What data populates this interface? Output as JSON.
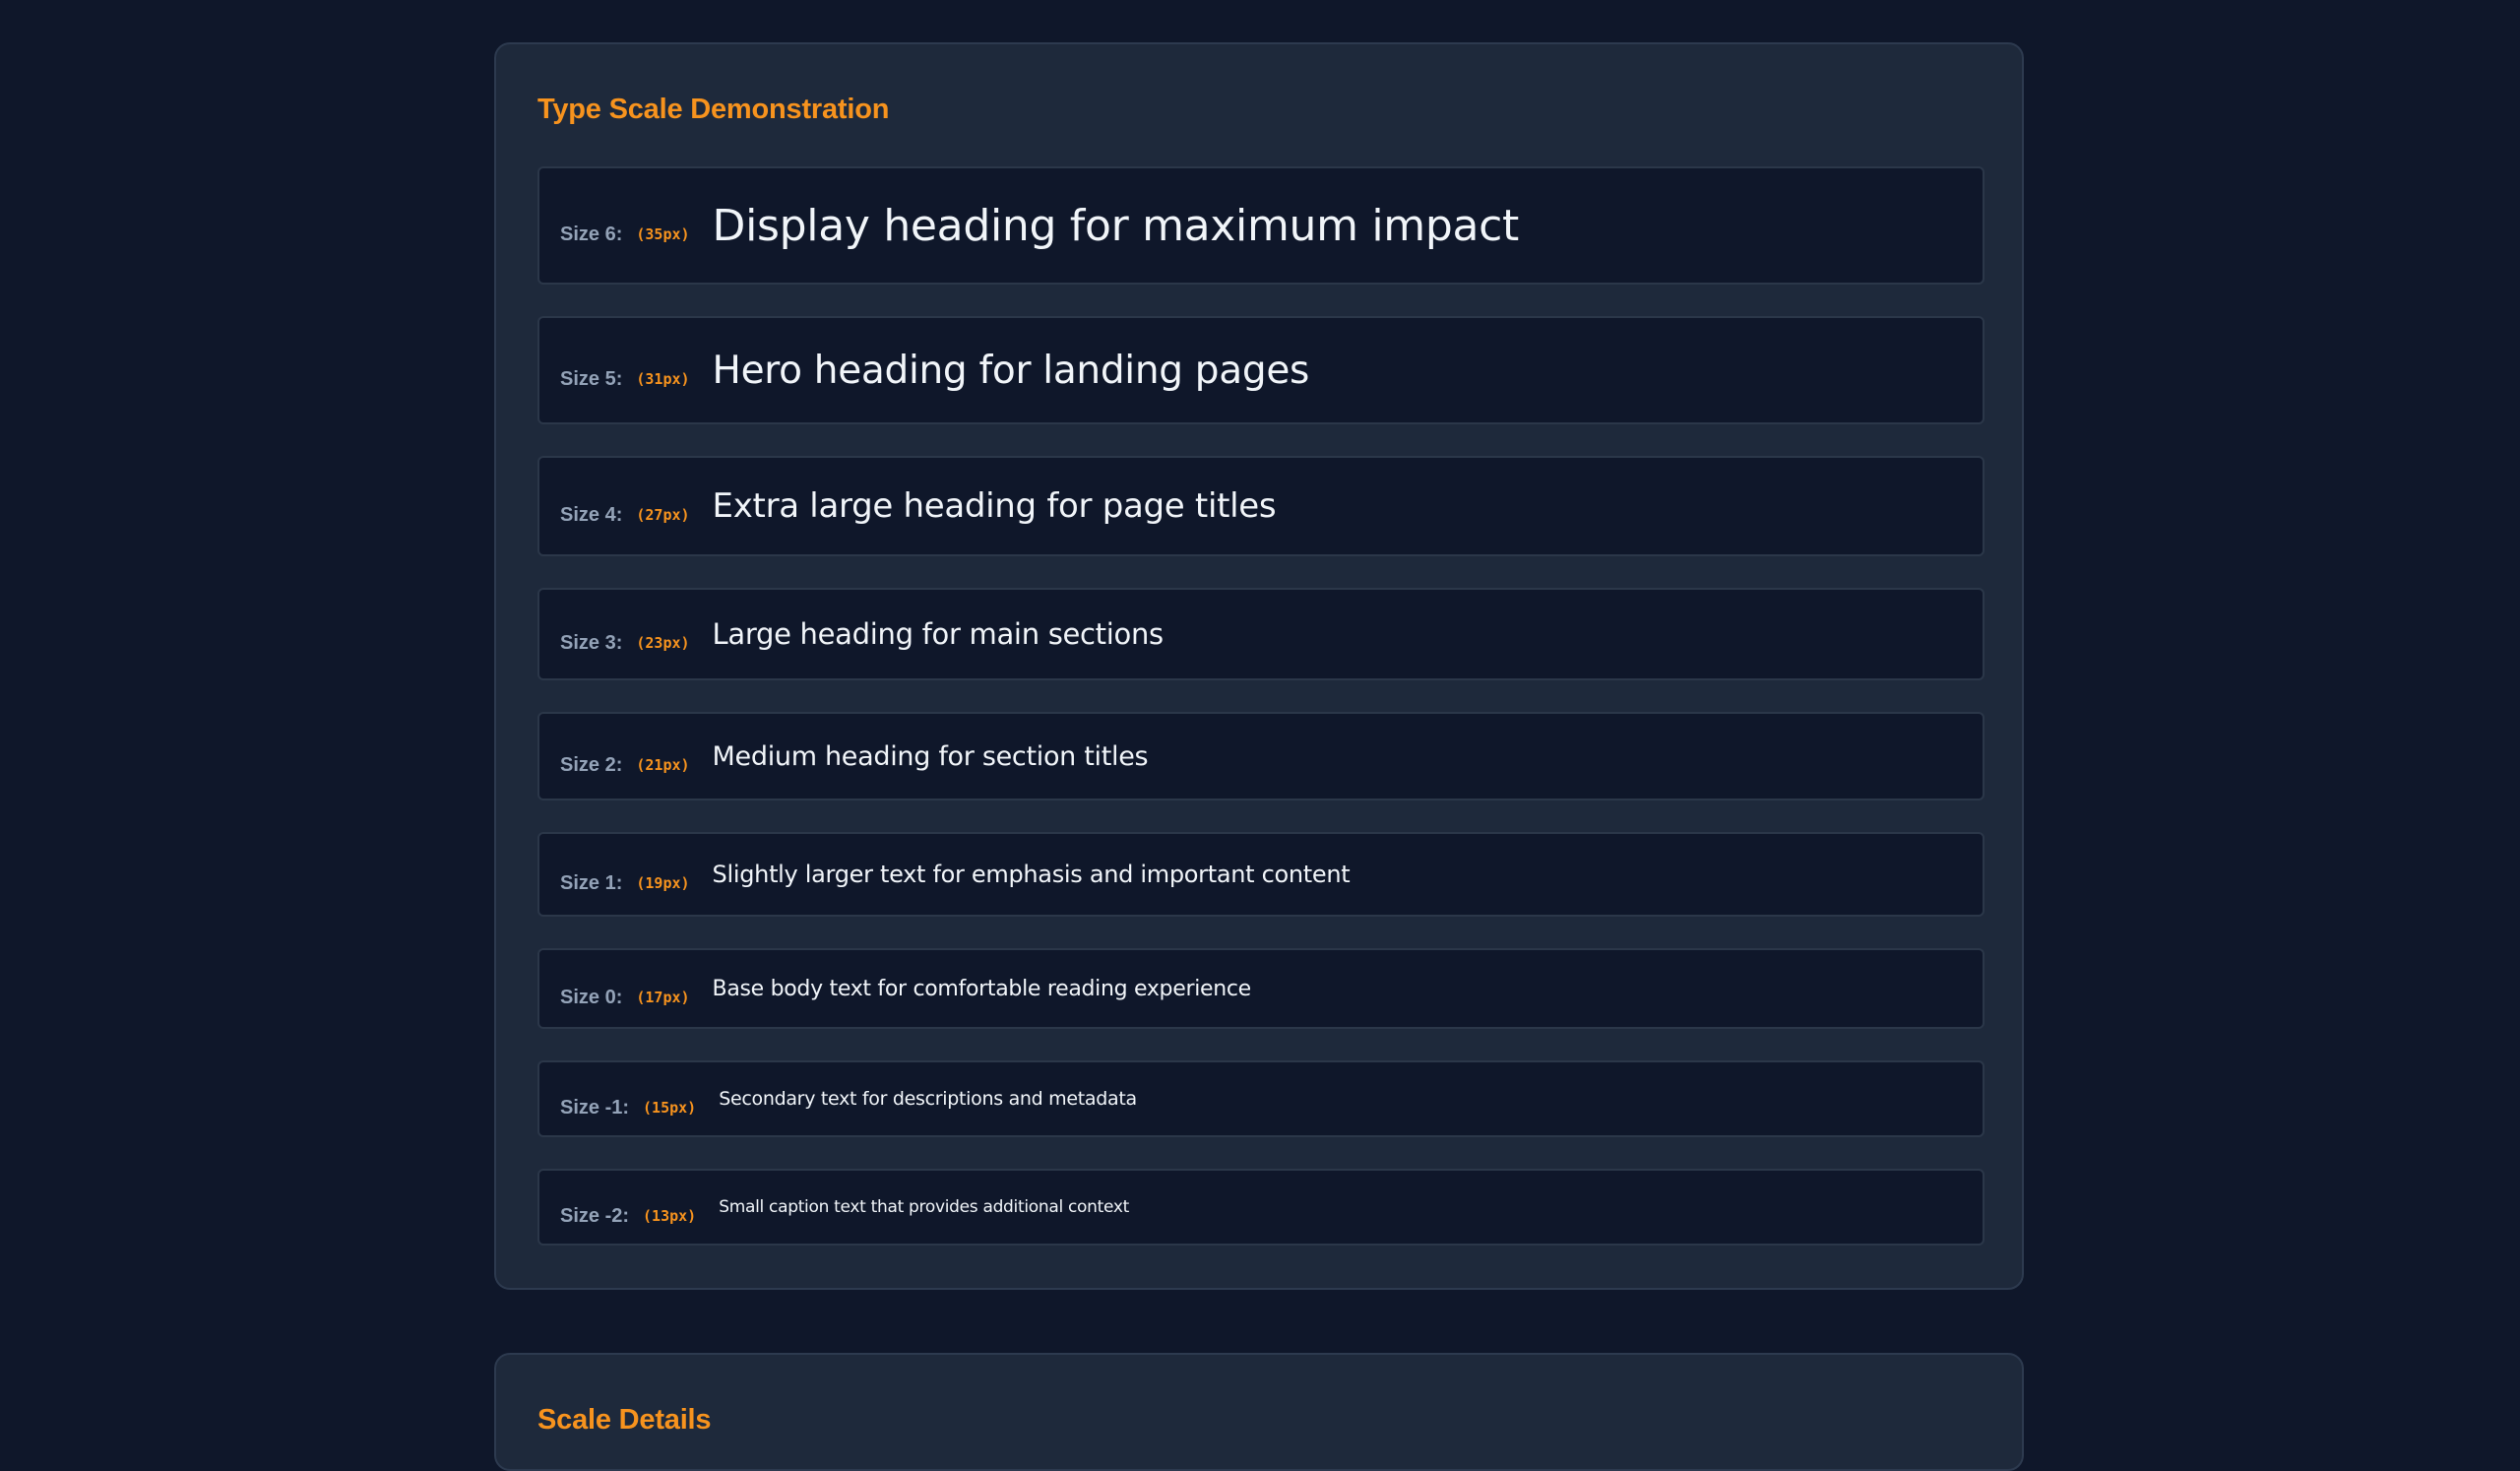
{
  "type_scale_panel": {
    "title": "Type Scale Demonstration",
    "rows": [
      {
        "label": "Size 6:",
        "px": "(35px)",
        "sample": "Display heading for maximum impact"
      },
      {
        "label": "Size 5:",
        "px": "(31px)",
        "sample": "Hero heading for landing pages"
      },
      {
        "label": "Size 4:",
        "px": "(27px)",
        "sample": "Extra large heading for page titles"
      },
      {
        "label": "Size 3:",
        "px": "(23px)",
        "sample": "Large heading for main sections"
      },
      {
        "label": "Size 2:",
        "px": "(21px)",
        "sample": "Medium heading for section titles"
      },
      {
        "label": "Size 1:",
        "px": "(19px)",
        "sample": "Slightly larger text for emphasis and important content"
      },
      {
        "label": "Size 0:",
        "px": "(17px)",
        "sample": "Base body text for comfortable reading experience"
      },
      {
        "label": "Size -1:",
        "px": "(15px)",
        "sample": "Secondary text for descriptions and metadata"
      },
      {
        "label": "Size -2:",
        "px": "(13px)",
        "sample": "Small caption text that provides additional context"
      }
    ]
  },
  "scale_details_panel": {
    "title": "Scale Details"
  },
  "colors": {
    "page_background": "#0f172a",
    "panel_background": "#1e293b",
    "row_background": "#0f172a",
    "accent": "#f7931e",
    "label": "#94a3b8",
    "sample_text": "#f1f5f9"
  }
}
